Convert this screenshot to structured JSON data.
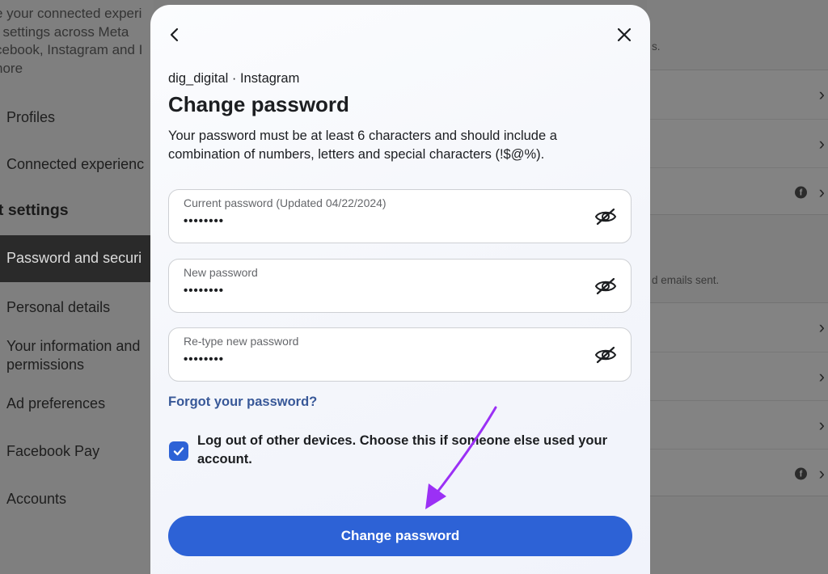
{
  "background": {
    "intro_lines": [
      "e your connected experi",
      "t settings across Meta",
      "cebook, Instagram and I",
      "nore"
    ],
    "nav": {
      "profiles": "Profiles",
      "connected": "Connected experienc",
      "section_title": "nt settings",
      "active": "Password and securi",
      "personal": "Personal details",
      "your_info_line1": "Your information and",
      "your_info_line2": "permissions",
      "ad_prefs": "Ad preferences",
      "facebook_pay": "Facebook Pay",
      "accounts": "Accounts"
    },
    "right": {
      "top_text": "s.",
      "emails_text": "d emails sent."
    }
  },
  "modal": {
    "account": "dig_digital · Instagram",
    "title": "Change password",
    "description": "Your password must be at least 6 characters and should include a combination of numbers, letters and special characters (!$@%).",
    "fields": [
      {
        "label": "Current password (Updated 04/22/2024)",
        "value": "••••••••"
      },
      {
        "label": "New password",
        "value": "••••••••"
      },
      {
        "label": "Re-type new password",
        "value": "••••••••"
      }
    ],
    "forgot": "Forgot your password?",
    "logout_checkbox_checked": true,
    "logout_label": "Log out of other devices. Choose this if someone else used your account.",
    "submit": "Change password"
  },
  "icons": [
    "back-arrow-icon",
    "close-icon",
    "eye-off-icon",
    "checkmark-icon",
    "chevron-right-icon",
    "facebook-icon"
  ],
  "colors": {
    "accent": "#2d62d6",
    "link": "#385898",
    "annotation_arrow": "#9b30f5"
  }
}
